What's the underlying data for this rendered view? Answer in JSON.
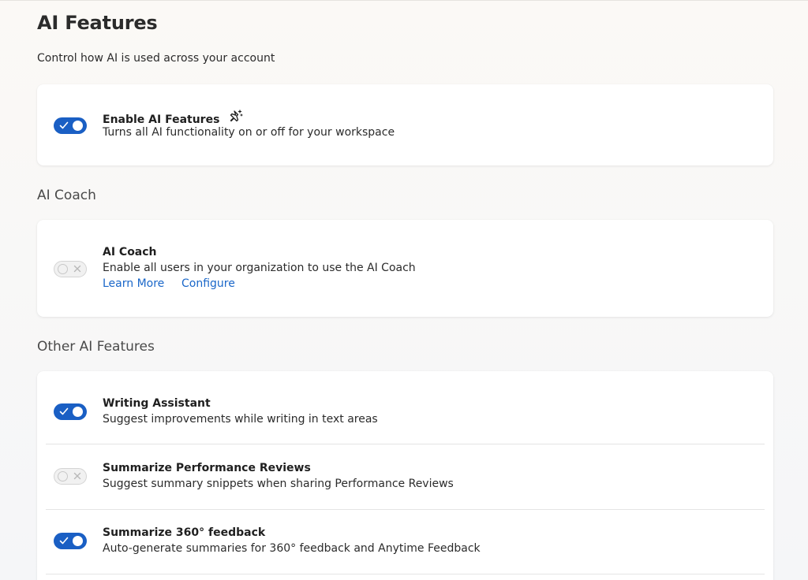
{
  "page": {
    "title": "AI Features",
    "subtitle": "Control how AI is used across your account"
  },
  "master": {
    "title": "Enable AI Features",
    "description": "Turns all AI functionality on or off for your workspace",
    "enabled": true,
    "icon": "sparkle-pin-icon"
  },
  "coach_section": {
    "heading": "AI Coach",
    "item": {
      "title": "AI Coach",
      "description": "Enable all users in your organization to use the AI Coach",
      "enabled": false,
      "links": {
        "learn_more": "Learn More",
        "configure": "Configure"
      }
    }
  },
  "other_section": {
    "heading": "Other AI Features",
    "items": [
      {
        "title": "Writing Assistant",
        "description": "Suggest improvements while writing in text areas",
        "enabled": true
      },
      {
        "title": "Summarize Performance Reviews",
        "description": "Suggest summary snippets when sharing Performance Reviews",
        "enabled": false
      },
      {
        "title": "Summarize 360° feedback",
        "description": "Auto-generate summaries for 360° feedback and Anytime Feedback",
        "enabled": true
      }
    ]
  },
  "colors": {
    "accent": "#1a5fc4",
    "link": "#1a67c9",
    "toggle_off_bg": "#f1f1f1"
  }
}
